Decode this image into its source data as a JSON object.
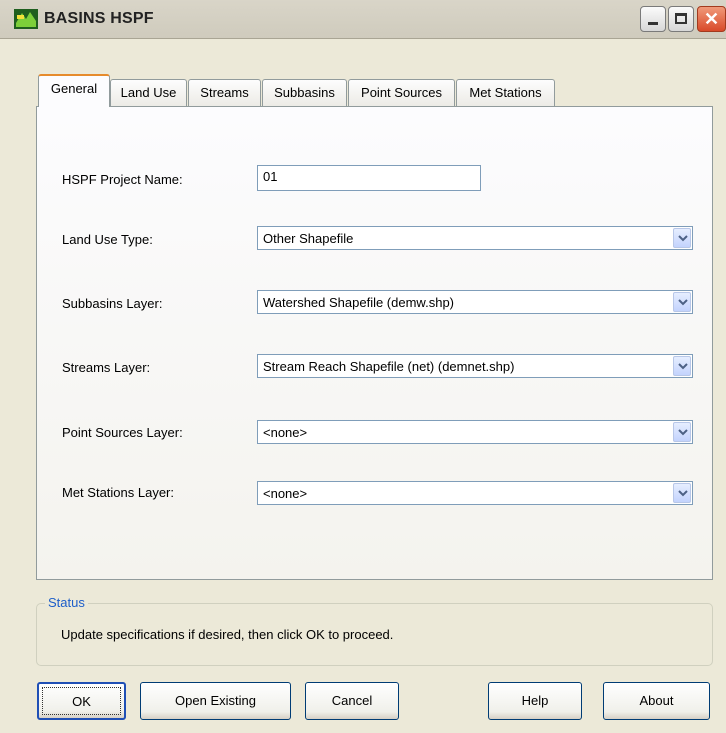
{
  "window": {
    "title": "BASINS HSPF",
    "icon": "basins-app-icon"
  },
  "tabs": [
    {
      "label": "General",
      "active": true
    },
    {
      "label": "Land Use"
    },
    {
      "label": "Streams"
    },
    {
      "label": "Subbasins"
    },
    {
      "label": "Point Sources"
    },
    {
      "label": "Met Stations"
    }
  ],
  "form": {
    "project_name": {
      "label": "HSPF Project Name:",
      "value": "01"
    },
    "land_use_type": {
      "label": "Land Use Type:",
      "value": "Other Shapefile"
    },
    "subbasins_layer": {
      "label": "Subbasins Layer:",
      "value": "Watershed Shapefile (demw.shp)"
    },
    "streams_layer": {
      "label": "Streams Layer:",
      "value": "Stream Reach Shapefile (net) (demnet.shp)"
    },
    "point_sources_layer": {
      "label": "Point Sources Layer:",
      "value": "<none>"
    },
    "met_stations_layer": {
      "label": "Met Stations Layer:",
      "value": "<none>"
    }
  },
  "status": {
    "title": "Status",
    "text": "Update specifications if desired, then click OK to proceed."
  },
  "buttons": {
    "ok": "OK",
    "open_existing": "Open Existing",
    "cancel": "Cancel",
    "help": "Help",
    "about": "About"
  },
  "colors": {
    "accent_tab": "#e68b2c",
    "status_title": "#1d5ec9",
    "close_button": "#d94a2a"
  }
}
